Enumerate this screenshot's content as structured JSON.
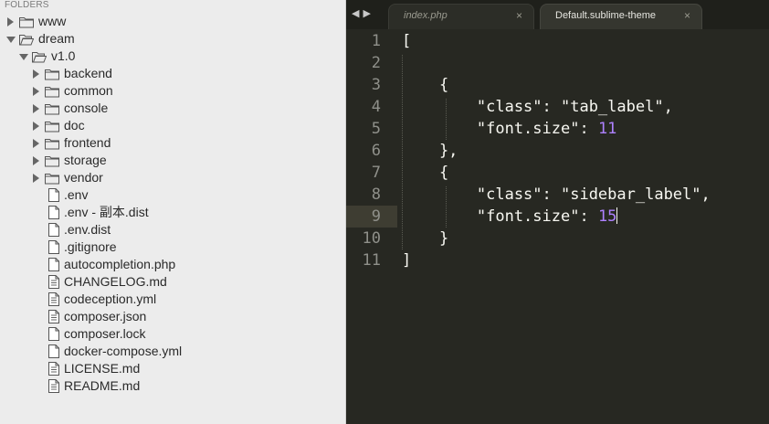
{
  "sidebar": {
    "title": "FOLDERS",
    "tree": [
      {
        "label": "www",
        "type": "folder",
        "state": "collapsed",
        "depth": 0
      },
      {
        "label": "dream",
        "type": "folder",
        "state": "expanded",
        "depth": 0
      },
      {
        "label": "v1.0",
        "type": "folder",
        "state": "expanded",
        "depth": 1
      },
      {
        "label": "backend",
        "type": "folder",
        "state": "collapsed",
        "depth": 2
      },
      {
        "label": "common",
        "type": "folder",
        "state": "collapsed",
        "depth": 2
      },
      {
        "label": "console",
        "type": "folder",
        "state": "collapsed",
        "depth": 2
      },
      {
        "label": "doc",
        "type": "folder",
        "state": "collapsed",
        "depth": 2
      },
      {
        "label": "frontend",
        "type": "folder",
        "state": "collapsed",
        "depth": 2
      },
      {
        "label": "storage",
        "type": "folder",
        "state": "collapsed",
        "depth": 2
      },
      {
        "label": "vendor",
        "type": "folder",
        "state": "collapsed",
        "depth": 2
      },
      {
        "label": ".env",
        "type": "file",
        "depth": 2
      },
      {
        "label": ".env - 副本.dist",
        "type": "file",
        "depth": 2
      },
      {
        "label": ".env.dist",
        "type": "file",
        "depth": 2
      },
      {
        "label": ".gitignore",
        "type": "file",
        "depth": 2
      },
      {
        "label": "autocompletion.php",
        "type": "file",
        "depth": 2
      },
      {
        "label": "CHANGELOG.md",
        "type": "file-text",
        "depth": 2
      },
      {
        "label": "codeception.yml",
        "type": "file-text",
        "depth": 2
      },
      {
        "label": "composer.json",
        "type": "file-text",
        "depth": 2
      },
      {
        "label": "composer.lock",
        "type": "file",
        "depth": 2
      },
      {
        "label": "docker-compose.yml",
        "type": "file",
        "depth": 2
      },
      {
        "label": "LICENSE.md",
        "type": "file-text",
        "depth": 2
      },
      {
        "label": "README.md",
        "type": "file-text",
        "depth": 2
      }
    ]
  },
  "editor": {
    "nav": {
      "prev": "◀",
      "next": "▶"
    },
    "tabs": [
      {
        "label": "index.php",
        "active": false,
        "close": "×"
      },
      {
        "label": "Default.sublime-theme",
        "active": true,
        "close": "×"
      }
    ],
    "lines": [
      {
        "n": "1",
        "parts": [
          {
            "t": "["
          }
        ]
      },
      {
        "n": "2",
        "parts": []
      },
      {
        "n": "3",
        "parts": [
          {
            "t": "    {"
          }
        ]
      },
      {
        "n": "4",
        "parts": [
          {
            "t": "        \"class\": \"tab_label\","
          }
        ]
      },
      {
        "n": "5",
        "parts": [
          {
            "t": "        \"font.size\": "
          },
          {
            "t": "11",
            "c": "num"
          }
        ]
      },
      {
        "n": "6",
        "parts": [
          {
            "t": "    },"
          }
        ]
      },
      {
        "n": "7",
        "parts": [
          {
            "t": "    {"
          }
        ]
      },
      {
        "n": "8",
        "parts": [
          {
            "t": "        \"class\": \"sidebar_label\","
          }
        ]
      },
      {
        "n": "9",
        "parts": [
          {
            "t": "        \"font.size\": "
          },
          {
            "t": "15",
            "c": "num"
          }
        ],
        "current": true
      },
      {
        "n": "10",
        "parts": [
          {
            "t": "    }"
          }
        ]
      },
      {
        "n": "11",
        "parts": [
          {
            "t": "]"
          }
        ]
      }
    ],
    "colors": {
      "background": "#272822",
      "number": "#ae81ff",
      "text": "#f8f8f2",
      "gutter_text": "#8f908a",
      "current_line": "#3e3d32"
    }
  }
}
